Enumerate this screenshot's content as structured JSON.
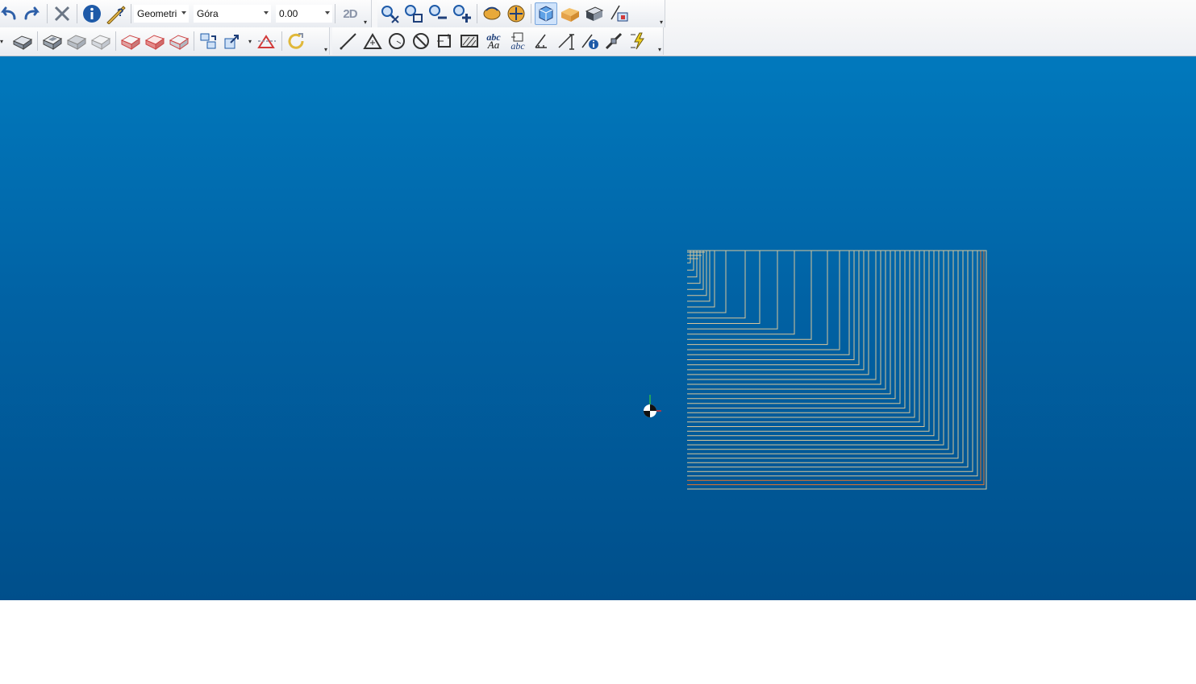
{
  "toolbar": {
    "mode_combo": {
      "value": "Geometri"
    },
    "view_combo": {
      "value": "Góra"
    },
    "depth_combo": {
      "value": "0.00"
    },
    "mode2d_label": "2D",
    "text_tool_label": "abc",
    "text_tool_sub": "Aa",
    "text_tool2_sub": "abc"
  },
  "colors": {
    "viewport_top": "#0179bd",
    "viewport_bottom": "#004f8b",
    "geometry_line": "#d8c59a",
    "geometry_line_accent": "#e8742a"
  }
}
